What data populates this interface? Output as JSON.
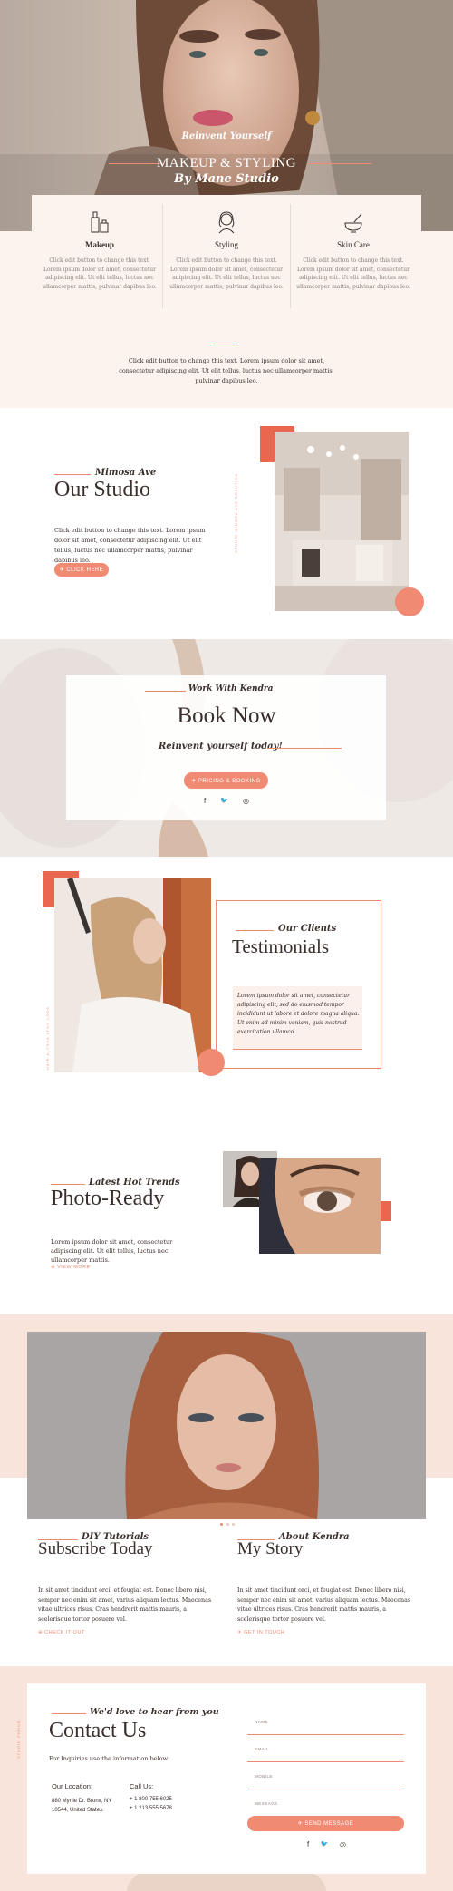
{
  "colors": {
    "accent": "#f08a73",
    "peach": "#f8e4da",
    "cream": "#fbf3ee",
    "dark": "#3a2f2c"
  },
  "hero": {
    "kicker": "Reinvent Yourself",
    "title": "MAKEUP & STYLING",
    "subtitle": "By Mane Studio"
  },
  "services": [
    {
      "icon": "makeup-bottles-icon",
      "title": "Makeup",
      "text": "Click edit button to change this text. Lorem ipsum dolor sit amet, consectetur adipiscing elit. Ut elit tellus, luctus nec ullamcorper mattis, pulvinar dapibus leo."
    },
    {
      "icon": "woman-hair-icon",
      "title": "Styling",
      "text": "Click edit button to change this text. Lorem ipsum dolor sit amet, consectetur adipiscing elit. Ut elit tellus, luctus nec ullamcorper mattis, pulvinar dapibus leo."
    },
    {
      "icon": "mortar-bowl-icon",
      "title": "Skin Care",
      "text": "Click edit button to change this text. Lorem ipsum dolor sit amet, consectetur adipiscing elit. Ut elit tellus, luctus nec ullamcorper mattis, pulvinar dapibus leo."
    }
  ],
  "intro_text": "Click edit button to change this text. Lorem ipsum dolor sit amet, consectetur adipiscing elit. Ut elit tellus, luctus nec ullamcorper mattis, pulvinar dapibus leo.",
  "studio": {
    "kicker": "Mimosa Ave",
    "title": "Our Studio",
    "text": "Click edit button to change this text. Lorem ipsum dolor sit amet, consectetur adipiscing elit. Ut elit tellus, luctus nec ullamcorper mattis, pulvinar dapibus leo.",
    "button": "✈ CLICK HERE",
    "vertical_caption": "STUDIO MIMOSA AVE SOLUTION"
  },
  "book": {
    "kicker": "Work With Kendra",
    "title": "Book Now",
    "tagline": "Reinvent yourself today!",
    "button": "✈ PRICING & BOOKING",
    "social": [
      "f",
      "🐦",
      "◎"
    ]
  },
  "testimonials": {
    "kicker": "Our Clients",
    "title": "Testimonials",
    "quote": "Lorem ipsum dolor sit amet, consectetur adipiscing elit, sed do eiusmod tempor incididunt ut labore et dolore magna aliqua. Ut enim ad minim veniam, quis nostrud exercitation ullamco",
    "vertical_caption": "HAIR ALYSSA LYNN LOOK"
  },
  "trends": {
    "kicker": "Latest Hot Trends",
    "title": "Photo-Ready",
    "text": "Lorem ipsum dolor sit amet, consectetur adipiscing elit. Ut elit tellus, luctus nec ullamcorper mattis.",
    "link": "⊕ VIEW MORE"
  },
  "slider_dots": 3,
  "subscribe": {
    "kicker": "DIY Tutorials",
    "title": "Subscribe Today",
    "text": "In sit amet tincidunt orci, et feugiat est. Donec libero nisi, semper nec enim sit amet, varius aliquam lectus. Maecenas vitae ultrices risus. Cras hendrerit mattis mauris, a scelerisque tortor posuere vel.",
    "link": "⊕ CHECK IT OUT"
  },
  "story": {
    "kicker": "About Kendra",
    "title": "My Story",
    "text": "In sit amet tincidunt orci, et feugiat est. Donec libero nisi, semper nec enim sit amet, varius aliquam lectus. Maecenas vitae ultrices risus. Cras hendrerit mattis mauris, a scelerisque tortor posuere vel.",
    "link": "✈ GET IN TOUCH"
  },
  "contact": {
    "side_caption": "STUDIO PHONE",
    "kicker": "We'd love to hear from you",
    "title": "Contact Us",
    "subtitle": "For Inquiries use the information below",
    "location_label": "Our Location:",
    "location": "880 Myrtle Dr. Bronx, NY 10544, United States.",
    "call_label": "Call Us:",
    "phone1": "+ 1 800 755 6025",
    "phone2": "+ 1 213 555 5678",
    "form": {
      "name_ph": "NAME",
      "email_ph": "EMAIL",
      "mobile_ph": "MOBILE",
      "message_ph": "MESSAGE",
      "submit": "✈ SEND MESSAGE"
    },
    "social": [
      "f",
      "🐦",
      "◎"
    ]
  }
}
